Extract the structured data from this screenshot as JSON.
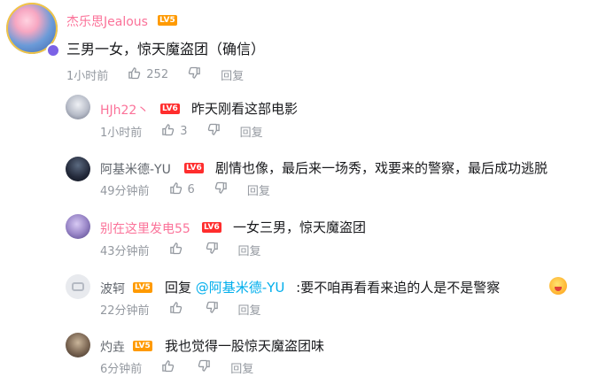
{
  "comment": {
    "user": "杰乐思Jealous",
    "level": "LV5",
    "text": "三男一女，惊天魔盗团（确信）",
    "time": "1小时前",
    "likes": "252",
    "reply_label": "回复"
  },
  "replies": [
    {
      "user": "HJh22丶",
      "level": "LV6",
      "text": "昨天刚看这部电影",
      "time": "1小时前",
      "likes": "3",
      "reply_label": "回复"
    },
    {
      "user": "阿基米德-YU",
      "level": "LV6",
      "text": "剧情也像，最后来一场秀，戏要来的警察，最后成功逃脱",
      "time": "49分钟前",
      "likes": "6",
      "reply_label": "回复"
    },
    {
      "user": "别在这里发电55",
      "level": "LV6",
      "text": "一女三男，惊天魔盗团",
      "time": "43分钟前",
      "likes": "",
      "reply_label": "回复"
    },
    {
      "user": "波轲",
      "level": "LV5",
      "prefix": "回复",
      "mention": "@阿基米德-YU",
      "text": ":要不咱再看看来追的人是不是警察",
      "time": "22分钟前",
      "likes": "",
      "reply_label": "回复"
    },
    {
      "user": "灼垚",
      "level": "LV5",
      "text": "我也觉得一股惊天魔盗团味",
      "time": "6分钟前",
      "likes": "",
      "reply_label": "回复"
    }
  ],
  "colors": {
    "pink": "#fb7299",
    "blue": "#00aeec",
    "meta": "#9499a0",
    "lv5": "#ff9a00",
    "lv6": "#ff2d2d"
  },
  "icons": {
    "like": "thumb-up-icon",
    "dislike": "thumb-down-icon"
  }
}
